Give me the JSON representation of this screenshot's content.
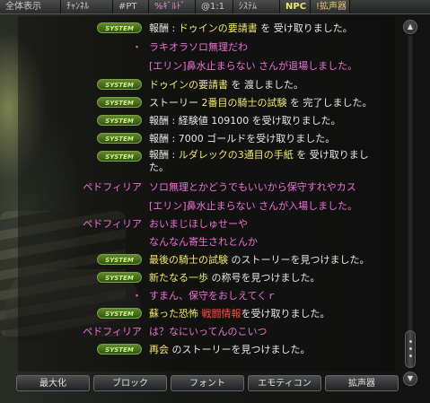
{
  "tabs": [
    {
      "label": "全体表示",
      "style": ""
    },
    {
      "label": "ﾁｬﾝﾈﾙ",
      "style": ""
    },
    {
      "label": "#PT",
      "style": ""
    },
    {
      "label": "%ｷﾞﾙﾄﾞ",
      "style": "pink"
    },
    {
      "label": "@1:1",
      "style": ""
    },
    {
      "label": "ｼｽﾃﾑ",
      "style": ""
    },
    {
      "label": "NPC",
      "style": "npc"
    },
    {
      "label": "!拡声器",
      "style": "loud"
    }
  ],
  "chat": {
    "badge_text": "SYSTEM",
    "lines": [
      {
        "type": "system",
        "parts": [
          [
            "w",
            "報酬 : "
          ],
          [
            "y",
            "ドゥインの要請書"
          ],
          [
            "w",
            " を 受け取りました。"
          ]
        ]
      },
      {
        "type": "speaker",
        "speaker": "・",
        "parts": [
          [
            "p",
            "ラキオラソロ無理だわ"
          ]
        ]
      },
      {
        "type": "plain",
        "parts": [
          [
            "p",
            "[エリン]鼻水止まらない さんが退場しました。"
          ]
        ]
      },
      {
        "type": "system",
        "parts": [
          [
            "y",
            "ドゥインの要請書"
          ],
          [
            "w",
            " を 渡しました。"
          ]
        ]
      },
      {
        "type": "system",
        "parts": [
          [
            "w",
            "ストーリー "
          ],
          [
            "y",
            "2番目の騎士の試験"
          ],
          [
            "w",
            " を 完了しました。"
          ]
        ]
      },
      {
        "type": "system",
        "parts": [
          [
            "w",
            "報酬 : 経験値 109100 を受け取りました。"
          ]
        ]
      },
      {
        "type": "system",
        "parts": [
          [
            "w",
            "報酬 : 7000 ゴールドを受け取りました。"
          ]
        ]
      },
      {
        "type": "system2",
        "parts": [
          [
            "w",
            "報酬 : "
          ],
          [
            "y",
            "ルダレックの3通目の手紙"
          ],
          [
            "w",
            " を 受け取りました。"
          ]
        ]
      },
      {
        "type": "speaker",
        "speaker": "ペドフィリア",
        "parts": [
          [
            "p",
            "ソロ無理とかどうでもいいから保守すれやカス"
          ]
        ]
      },
      {
        "type": "plain",
        "parts": [
          [
            "p",
            "[エリン]鼻水止まらない さんが入場しました。"
          ]
        ]
      },
      {
        "type": "speaker",
        "speaker": "ペドフィリア",
        "parts": [
          [
            "p",
            "おいまじほしゅせーや"
          ]
        ]
      },
      {
        "type": "plain",
        "parts": [
          [
            "p",
            "なんなん寄生されとんか"
          ]
        ]
      },
      {
        "type": "system",
        "parts": [
          [
            "y",
            "最後の騎士の試験"
          ],
          [
            "w",
            " のストーリーを見つけました。"
          ]
        ]
      },
      {
        "type": "system",
        "parts": [
          [
            "y",
            "新たなる一歩"
          ],
          [
            "w",
            " の称号を見つけました。"
          ]
        ]
      },
      {
        "type": "speaker",
        "speaker": "・",
        "parts": [
          [
            "p",
            "すまん、保守をおしえてくｒ"
          ]
        ]
      },
      {
        "type": "system",
        "parts": [
          [
            "y",
            "蘇った恐怖"
          ],
          [
            "r",
            " 戦闘情報"
          ],
          [
            "w",
            "を受け取りました。"
          ]
        ]
      },
      {
        "type": "speaker",
        "speaker": "ペドフィリア",
        "parts": [
          [
            "p",
            "は？なにいってんのこいつ"
          ]
        ]
      },
      {
        "type": "system",
        "parts": [
          [
            "y",
            "再会"
          ],
          [
            "w",
            " のストーリーを見つけました。"
          ]
        ]
      }
    ]
  },
  "scrollbar": {
    "up_glyph": "▲",
    "down_glyph": "▼"
  },
  "buttons": [
    {
      "id": "maximize",
      "label": "最大化"
    },
    {
      "id": "block",
      "label": "ブロック"
    },
    {
      "id": "font",
      "label": "フォント"
    },
    {
      "id": "emoticon",
      "label": "エモティコン"
    },
    {
      "id": "megaphone",
      "label": "拡声器"
    }
  ],
  "colors": {
    "system_badge": "#5f8a2e",
    "speaker_pink": "#ee6fd6",
    "item_yellow": "#f3e86a",
    "combat_red": "#ff4a3a"
  }
}
